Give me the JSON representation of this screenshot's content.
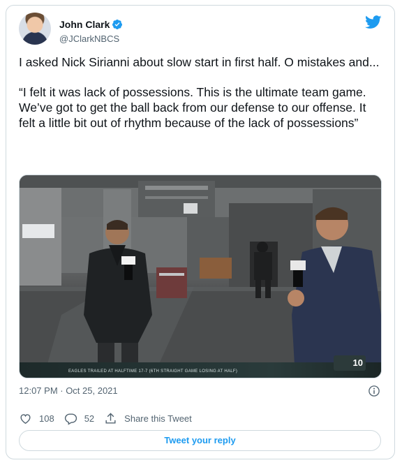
{
  "author": {
    "name": "John Clark",
    "handle": "@JClarkNBCS"
  },
  "tweet": {
    "paragraphs": [
      "I asked Nick Sirianni about slow start in first half. O mistakes and...",
      "“I felt it was lack of possessions. This is the ultimate team game. We’ve got to get the ball back from our defense to our offense. It felt a little bit out of rhythm because of the lack of possessions”"
    ]
  },
  "media": {
    "chyron": "EAGLES TRAILED AT HALFTIME 17-7 (6TH STRAIGHT GAME LOSING AT HALF)",
    "channel_logo": "10"
  },
  "meta": {
    "timestamp": "12:07 PM · Oct 25, 2021"
  },
  "actions": {
    "likes": "108",
    "replies": "52",
    "share_label": "Share this Tweet"
  },
  "reply_button": "Tweet your reply",
  "colors": {
    "accent": "#1d9bf0",
    "secondary_text": "#536471",
    "border": "#cfd9de"
  },
  "icons": [
    "verified-badge-icon",
    "twitter-bird-icon",
    "info-icon",
    "heart-icon",
    "reply-bubble-icon",
    "share-icon"
  ]
}
